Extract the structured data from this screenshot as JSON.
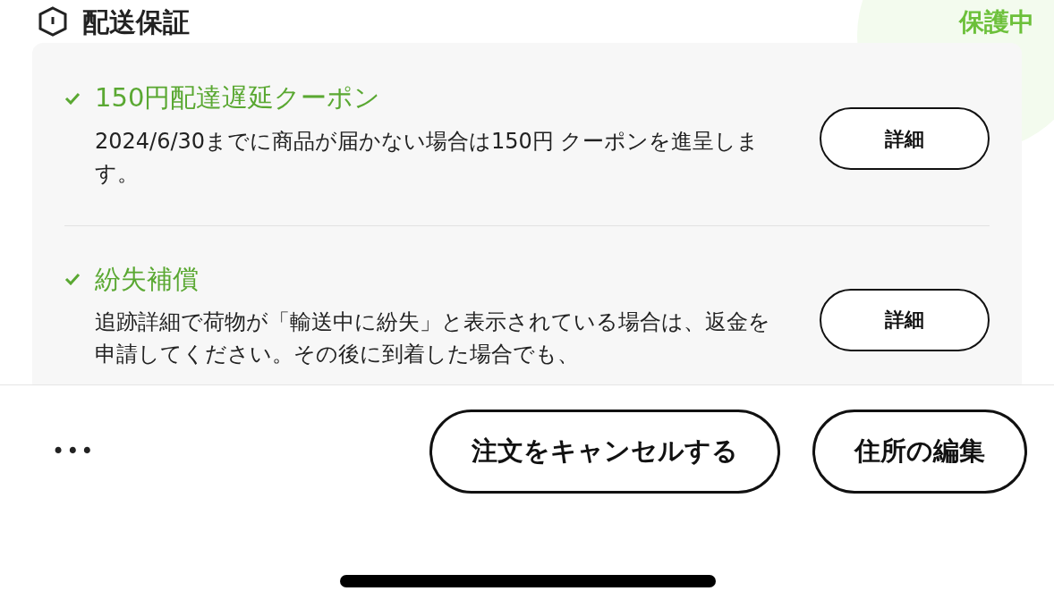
{
  "section": {
    "title": "配送保証",
    "badge": "保護中"
  },
  "guarantees": [
    {
      "title": "150円配達遅延クーポン",
      "description": "2024/6/30までに商品が届かない場合は150円 クーポンを進呈します。",
      "covered": true,
      "button": "詳細"
    },
    {
      "title": "紛失補償",
      "description": "追跡詳細で荷物が「輸送中に紛失」と表示されている場合は、返金を申請してください。その後に到着した場合でも、",
      "covered": true,
      "button": "詳細"
    }
  ],
  "bottom_bar": {
    "more": "•••",
    "buttons": [
      "注文をキャンセルする",
      "住所の編集"
    ]
  }
}
